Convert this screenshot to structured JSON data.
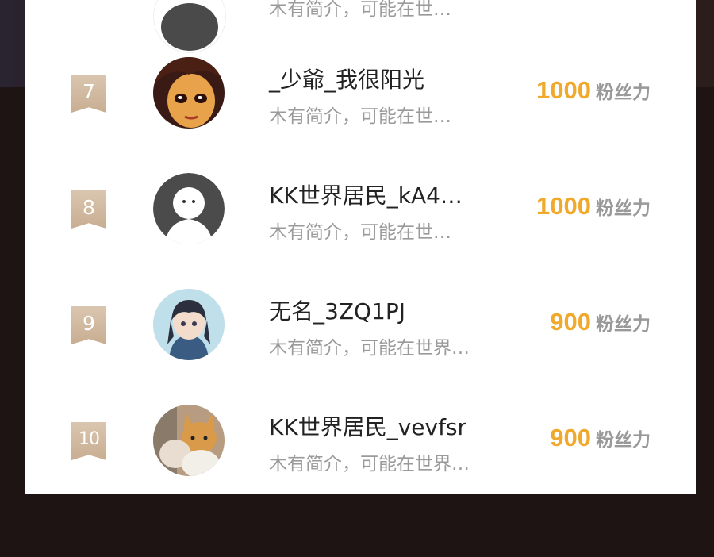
{
  "top_partial": {
    "desc": "木有简介，可能在世…"
  },
  "entries": [
    {
      "rank": "7",
      "name": "_少爺_我很阳光",
      "desc": "木有简介，可能在世…",
      "score": "1000",
      "unit": "粉丝力",
      "avatar": "anime-girl-avatar"
    },
    {
      "rank": "8",
      "name": "KK世界居民_kA4…",
      "desc": "木有简介，可能在世…",
      "score": "1000",
      "unit": "粉丝力",
      "avatar": "default-ghost-avatar"
    },
    {
      "rank": "9",
      "name": "无名_3ZQ1PJ",
      "desc": "木有简介，可能在世界…",
      "score": "900",
      "unit": "粉丝力",
      "avatar": "anime-boy-avatar"
    },
    {
      "rank": "10",
      "name": "KK世界居民_vevfsr",
      "desc": "木有简介，可能在世界…",
      "score": "900",
      "unit": "粉丝力",
      "avatar": "cats-avatar"
    }
  ],
  "colors": {
    "rank_badge": "#cfb597",
    "score": "#f0a92b",
    "desc": "#9a9a9a",
    "name": "#222222"
  }
}
